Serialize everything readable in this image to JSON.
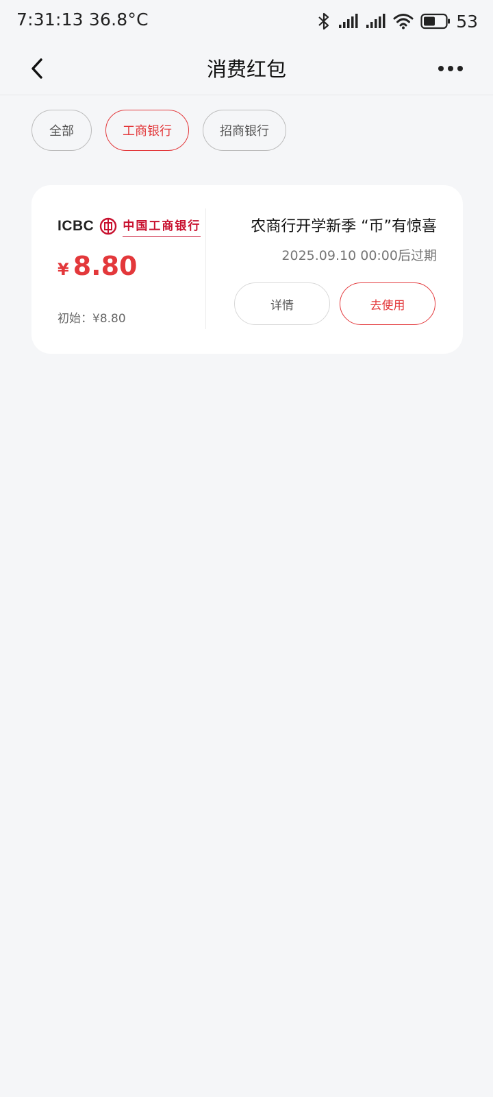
{
  "status_bar": {
    "time_temp": "7:31:13 36.8°C",
    "battery": "53",
    "icons": [
      "bluetooth-icon",
      "signal-icon",
      "signal-icon",
      "wifi-icon",
      "battery-icon"
    ]
  },
  "nav": {
    "title": "消费红包",
    "back_icon": "chevron-left-icon",
    "more_icon": "more-dots-icon"
  },
  "filters": [
    {
      "label": "全部",
      "active": false
    },
    {
      "label": "工商银行",
      "active": true
    },
    {
      "label": "招商银行",
      "active": false
    }
  ],
  "coupon": {
    "bank_logo_en": "ICBC",
    "bank_logo_cn": "中国工商银行",
    "currency": "¥",
    "amount": "8.80",
    "initial": "初始：¥8.80",
    "title": "农商行开学新季 “币”有惊喜",
    "expiry": "2025.09.10 00:00后过期",
    "detail_label": "详情",
    "use_label": "去使用"
  },
  "colors": {
    "accent": "#e3383b",
    "background": "#f5f6f8",
    "card": "#ffffff"
  }
}
